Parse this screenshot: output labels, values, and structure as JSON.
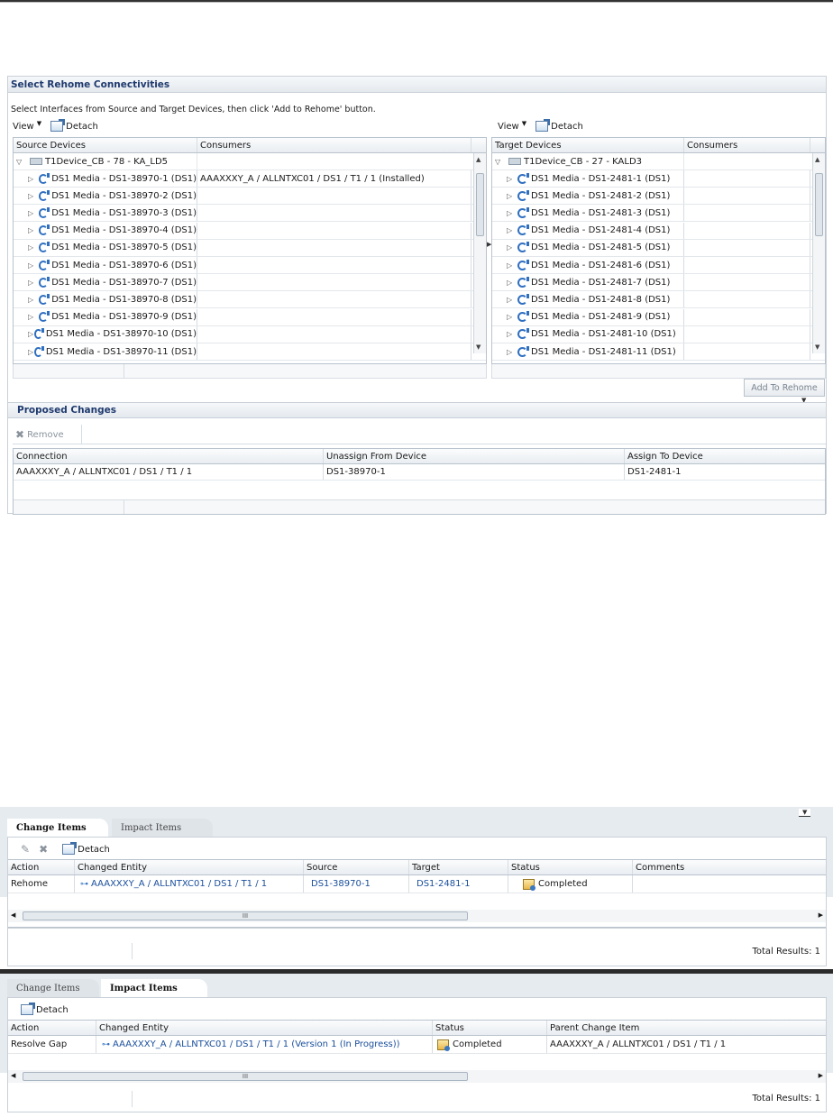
{
  "section1": {
    "title": "Select Rehome Connectivities",
    "instruction": "Select Interfaces from Source and Target Devices, then click 'Add to Rehome' button.",
    "source": {
      "view_label": "View",
      "detach_label": "Detach",
      "col_devices": "Source Devices",
      "col_consumers": "Consumers",
      "root_label": "T1Device_CB - 78 - KA_LD5",
      "rows": [
        {
          "label": "DS1 Media - DS1-38970-1 (DS1)",
          "consumer": "AAAXXXY_A / ALLNTXC01 / DS1 / T1 / 1 (Installed)"
        },
        {
          "label": "DS1 Media - DS1-38970-2 (DS1)",
          "consumer": ""
        },
        {
          "label": "DS1 Media - DS1-38970-3 (DS1)",
          "consumer": ""
        },
        {
          "label": "DS1 Media - DS1-38970-4 (DS1)",
          "consumer": ""
        },
        {
          "label": "DS1 Media - DS1-38970-5 (DS1)",
          "consumer": ""
        },
        {
          "label": "DS1 Media - DS1-38970-6 (DS1)",
          "consumer": ""
        },
        {
          "label": "DS1 Media - DS1-38970-7 (DS1)",
          "consumer": ""
        },
        {
          "label": "DS1 Media - DS1-38970-8 (DS1)",
          "consumer": ""
        },
        {
          "label": "DS1 Media - DS1-38970-9 (DS1)",
          "consumer": ""
        },
        {
          "label": "DS1 Media - DS1-38970-10 (DS1)",
          "consumer": ""
        },
        {
          "label": "DS1 Media - DS1-38970-11 (DS1)",
          "consumer": ""
        }
      ]
    },
    "target": {
      "view_label": "View",
      "detach_label": "Detach",
      "col_devices": "Target Devices",
      "col_consumers": "Consumers",
      "root_label": "T1Device_CB - 27 - KALD3",
      "rows": [
        {
          "label": "DS1 Media - DS1-2481-1 (DS1)"
        },
        {
          "label": "DS1 Media - DS1-2481-2 (DS1)"
        },
        {
          "label": "DS1 Media - DS1-2481-3 (DS1)"
        },
        {
          "label": "DS1 Media - DS1-2481-4 (DS1)"
        },
        {
          "label": "DS1 Media - DS1-2481-5 (DS1)"
        },
        {
          "label": "DS1 Media - DS1-2481-6 (DS1)"
        },
        {
          "label": "DS1 Media - DS1-2481-7 (DS1)"
        },
        {
          "label": "DS1 Media - DS1-2481-8 (DS1)"
        },
        {
          "label": "DS1 Media - DS1-2481-9 (DS1)"
        },
        {
          "label": "DS1 Media - DS1-2481-10 (DS1)"
        },
        {
          "label": "DS1 Media - DS1-2481-11 (DS1)"
        }
      ]
    },
    "add_button": "Add To Rehome"
  },
  "proposed": {
    "title": "Proposed Changes",
    "remove_label": "Remove",
    "columns": [
      "Connection",
      "Unassign From Device",
      "Assign To Device"
    ],
    "row": {
      "connection": "AAAXXXY_A / ALLNTXC01 / DS1 / T1 / 1",
      "unassign": "DS1-38970-1",
      "assign": "DS1-2481-1"
    }
  },
  "panel2": {
    "tab_active": "Change Items",
    "tab_inactive": "Impact Items",
    "detach_label": "Detach",
    "columns": [
      "Action",
      "Changed Entity",
      "Source",
      "Target",
      "Status",
      "Comments"
    ],
    "row": {
      "action": "Rehome",
      "entity": "AAAXXXY_A / ALLNTXC01 / DS1 / T1 / 1",
      "source": "DS1-38970-1",
      "target": "DS1-2481-1",
      "status": "Completed",
      "comments": ""
    },
    "scroll_grip": "III",
    "total": "Total Results: 1"
  },
  "panel3": {
    "tab_inactive": "Change Items",
    "tab_active": "Impact Items",
    "detach_label": "Detach",
    "columns": [
      "Action",
      "Changed Entity",
      "Status",
      "Parent Change Item"
    ],
    "row": {
      "action": "Resolve Gap",
      "entity": "AAAXXXY_A / ALLNTXC01 / DS1 / T1 / 1 (Version 1 (In Progress))",
      "status": "Completed",
      "parent": "AAAXXXY_A / ALLNTXC01 / DS1 / T1 / 1"
    },
    "scroll_grip": "III",
    "total": "Total Results: 1"
  }
}
